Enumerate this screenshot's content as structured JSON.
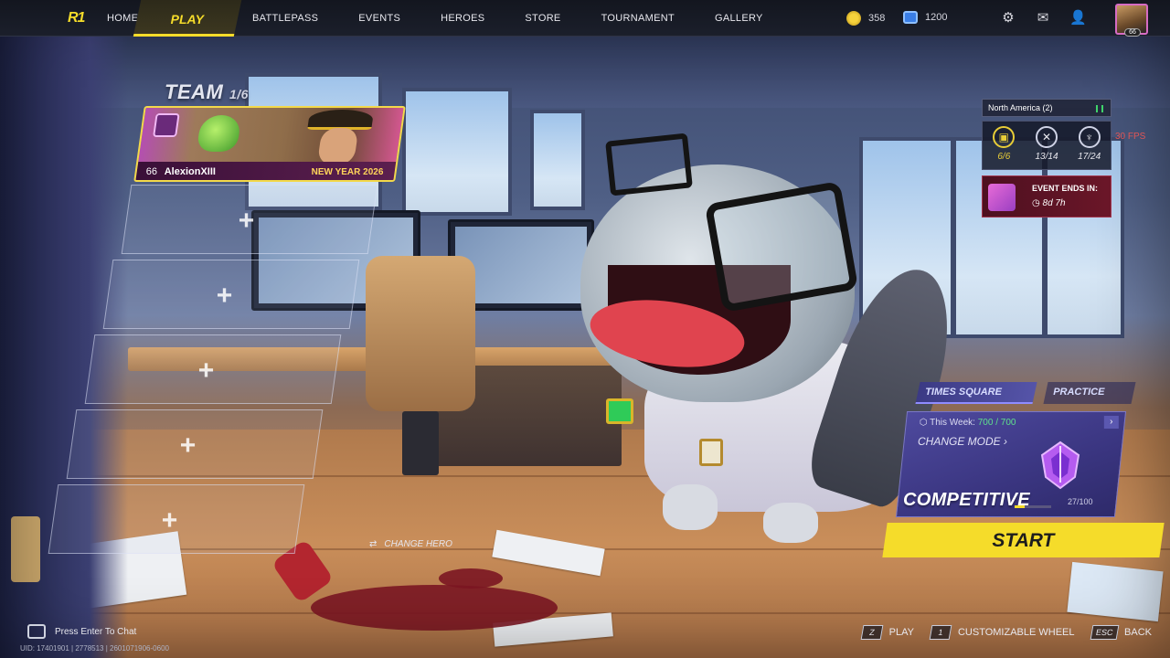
{
  "nav": {
    "logo": "R1",
    "home": "HOME",
    "play": "PLAY",
    "battlepass": "BATTLEPASS",
    "events": "EVENTS",
    "heroes": "HEROES",
    "store": "STORE",
    "tournament": "TOURNAMENT",
    "gallery": "GALLERY"
  },
  "currency": {
    "coins": "358",
    "units": "1200"
  },
  "avatar": {
    "level": "66"
  },
  "team": {
    "title": "TEAM",
    "count": "1/6",
    "player": {
      "level": "66",
      "name": "AlexionXIII",
      "tag": "NEW YEAR 2026"
    },
    "change_hero": "CHANGE HERO"
  },
  "region": {
    "name": "North America (2)",
    "fps": "30 FPS"
  },
  "stats": [
    {
      "icon": "badge-icon",
      "value": "6/6"
    },
    {
      "icon": "crossed-swords-icon",
      "value": "13/14"
    },
    {
      "icon": "trophy-icon",
      "value": "17/24"
    }
  ],
  "event": {
    "label": "EVENT ENDS IN:",
    "time": "8d 7h"
  },
  "mode": {
    "map": "TIMES SQUARE",
    "practice": "PRACTICE",
    "week_label": "This Week:",
    "week_value": "700 / 700",
    "change_mode": "CHANGE MODE",
    "name": "COMPETITIVE",
    "rank_progress": 0.27,
    "rank_value": "27/100",
    "start": "START"
  },
  "chat": {
    "placeholder": "Press Enter To Chat"
  },
  "uid": "UID: 17401901 | 2778513 | 2601071906-0600",
  "hotkeys": [
    {
      "key": "Z",
      "label": "PLAY"
    },
    {
      "key": "1",
      "label": "CUSTOMIZABLE WHEEL"
    },
    {
      "key": "ESC",
      "label": "BACK"
    }
  ],
  "colors": {
    "accent": "#f5dc2a",
    "mode_panel": "#3a3580",
    "event": "#6b1628"
  }
}
